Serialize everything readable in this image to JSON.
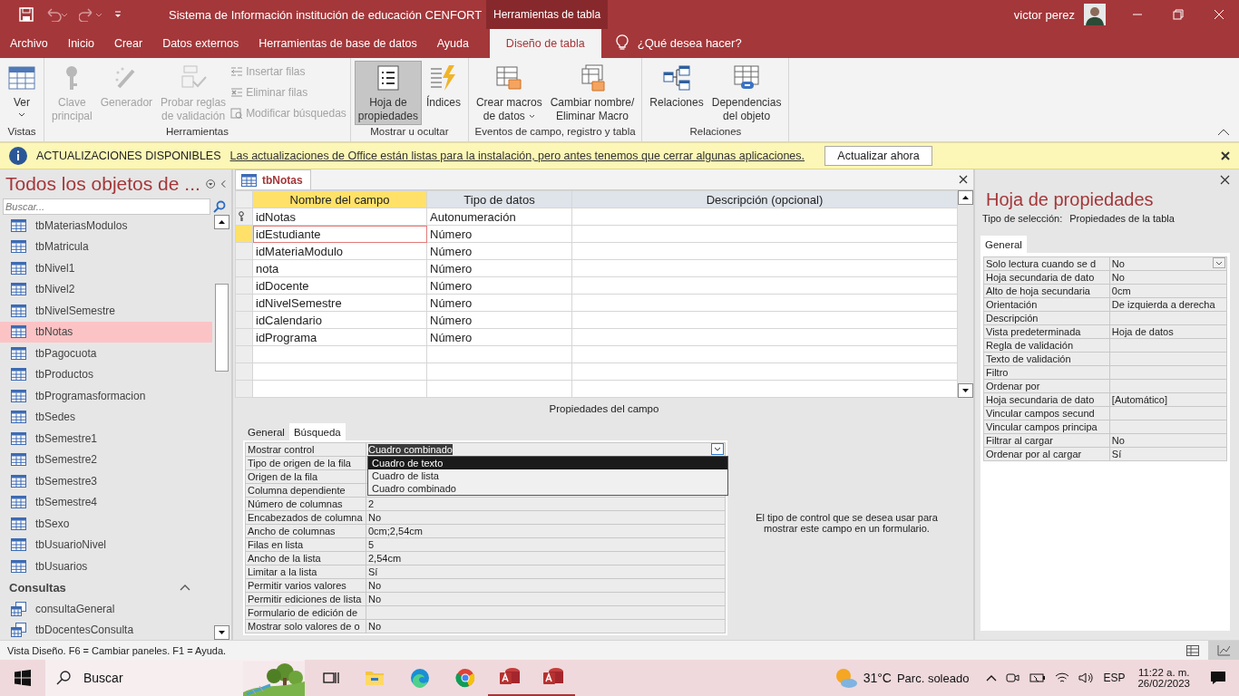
{
  "window": {
    "title": "Sistema de Información institución de educación CENFORT",
    "contextual_tab": "Herramientas de tabla",
    "user": "victor perez"
  },
  "ribbon_tabs": [
    {
      "label": "Archivo",
      "selected": false
    },
    {
      "label": "Inicio",
      "selected": false
    },
    {
      "label": "Crear",
      "selected": false
    },
    {
      "label": "Datos externos",
      "selected": false
    },
    {
      "label": "Herramientas de base de datos",
      "selected": false
    },
    {
      "label": "Ayuda",
      "selected": false
    },
    {
      "label": "Diseño de tabla",
      "selected": true
    }
  ],
  "tell_me": "¿Qué desea hacer?",
  "ribbon_groups": [
    {
      "label": "Vistas",
      "buttons": [
        {
          "kind": "large",
          "lines": [
            "Ver"
          ],
          "menu": true,
          "disabled": false,
          "selected": false
        }
      ]
    },
    {
      "label": "Herramientas",
      "buttons": [
        {
          "kind": "large",
          "lines": [
            "Clave",
            "principal"
          ],
          "disabled": true,
          "selected": false
        },
        {
          "kind": "large",
          "lines": [
            "Generador"
          ],
          "disabled": true,
          "selected": false
        },
        {
          "kind": "large",
          "lines": [
            "Probar reglas",
            "de validación"
          ],
          "disabled": true,
          "selected": false
        },
        {
          "kind": "small",
          "lines": [
            "Insertar filas"
          ],
          "disabled": true
        },
        {
          "kind": "small",
          "lines": [
            "Eliminar filas"
          ],
          "disabled": true
        },
        {
          "kind": "small",
          "lines": [
            "Modificar búsquedas"
          ],
          "disabled": true
        }
      ]
    },
    {
      "label": "Mostrar u ocultar",
      "buttons": [
        {
          "kind": "large",
          "lines": [
            "Hoja de",
            "propiedades"
          ],
          "disabled": false,
          "selected": true
        },
        {
          "kind": "large",
          "lines": [
            "Índices"
          ],
          "disabled": false,
          "selected": false
        }
      ]
    },
    {
      "label": "Eventos de campo, registro y tabla",
      "buttons": [
        {
          "kind": "large",
          "lines": [
            "Crear macros",
            "de datos"
          ],
          "menu": true,
          "disabled": false,
          "selected": false
        },
        {
          "kind": "large",
          "lines": [
            "Cambiar nombre/",
            "Eliminar Macro"
          ],
          "disabled": false,
          "selected": false
        }
      ]
    },
    {
      "label": "Relaciones",
      "buttons": [
        {
          "kind": "large",
          "lines": [
            "Relaciones"
          ],
          "disabled": false,
          "selected": false
        },
        {
          "kind": "large",
          "lines": [
            "Dependencias",
            "del objeto"
          ],
          "disabled": false,
          "selected": false
        }
      ]
    }
  ],
  "message_bar": {
    "title": "ACTUALIZACIONES DISPONIBLES",
    "text": "Las actualizaciones de Office están listas para la instalación, pero antes tenemos que cerrar algunas aplicaciones.",
    "button": "Actualizar ahora"
  },
  "nav": {
    "title": "Todos los objetos de ...",
    "search_placeholder": "Buscar...",
    "items": [
      {
        "label": "tbMateriasModulos",
        "selected": false
      },
      {
        "label": "tbMatricula",
        "selected": false
      },
      {
        "label": "tbNivel1",
        "selected": false
      },
      {
        "label": "tbNivel2",
        "selected": false
      },
      {
        "label": "tbNivelSemestre",
        "selected": false
      },
      {
        "label": "tbNotas",
        "selected": true
      },
      {
        "label": "tbPagocuota",
        "selected": false
      },
      {
        "label": "tbProductos",
        "selected": false
      },
      {
        "label": "tbProgramasformacion",
        "selected": false
      },
      {
        "label": "tbSedes",
        "selected": false
      },
      {
        "label": "tbSemestre1",
        "selected": false
      },
      {
        "label": "tbSemestre2",
        "selected": false
      },
      {
        "label": "tbSemestre3",
        "selected": false
      },
      {
        "label": "tbSemestre4",
        "selected": false
      },
      {
        "label": "tbSexo",
        "selected": false
      },
      {
        "label": "tbUsuarioNivel",
        "selected": false
      },
      {
        "label": "tbUsuarios",
        "selected": false
      }
    ],
    "sections": [
      {
        "label": "Consultas",
        "expanded": true,
        "items": [
          {
            "label": "consultaGeneral",
            "selected": false
          },
          {
            "label": "tbDocentesConsulta",
            "selected": false
          }
        ]
      }
    ]
  },
  "document_tab": "tbNotas",
  "design": {
    "columns": [
      {
        "label": "Nombre del campo",
        "selected": true
      },
      {
        "label": "Tipo de datos",
        "selected": false
      },
      {
        "label": "Descripción (opcional)",
        "selected": false
      }
    ],
    "rows": [
      {
        "name": "idNotas",
        "type": "Autonumeración",
        "primary_key": true,
        "selected": false
      },
      {
        "name": "idEstudiante",
        "type": "Número",
        "primary_key": false,
        "selected": true
      },
      {
        "name": "idMateriaModulo",
        "type": "Número",
        "primary_key": false,
        "selected": false
      },
      {
        "name": "nota",
        "type": "Número",
        "primary_key": false,
        "selected": false
      },
      {
        "name": "idDocente",
        "type": "Número",
        "primary_key": false,
        "selected": false
      },
      {
        "name": "idNivelSemestre",
        "type": "Número",
        "primary_key": false,
        "selected": false
      },
      {
        "name": "idCalendario",
        "type": "Número",
        "primary_key": false,
        "selected": false
      },
      {
        "name": "idPrograma",
        "type": "Número",
        "primary_key": false,
        "selected": false
      }
    ]
  },
  "field_properties": {
    "label": "Propiedades del campo",
    "tabs": [
      {
        "label": "General",
        "selected": false
      },
      {
        "label": "Búsqueda",
        "selected": true
      }
    ],
    "rows": [
      {
        "label": "Mostrar control",
        "value": "Cuadro combinado",
        "selected": true
      },
      {
        "label": "Tipo de origen de la fila"
      },
      {
        "label": "Origen de la fila"
      },
      {
        "label": "Columna dependiente"
      },
      {
        "label": "Número de columnas",
        "value": "2",
        "selected": false
      },
      {
        "label": "Encabezados de columna",
        "value": "No",
        "selected": false
      },
      {
        "label": "Ancho de columnas",
        "value": "0cm;2,54cm",
        "selected": false
      },
      {
        "label": "Filas en lista",
        "value": "5",
        "selected": false
      },
      {
        "label": "Ancho de la lista",
        "value": "2,54cm",
        "selected": false
      },
      {
        "label": "Limitar a la lista",
        "value": "Sí",
        "selected": false
      },
      {
        "label": "Permitir varios valores",
        "value": "No",
        "selected": false
      },
      {
        "label": "Permitir ediciones de lista",
        "value": "No",
        "selected": false
      },
      {
        "label": "Formulario de edición de",
        "selected": false
      },
      {
        "label": "Mostrar solo valores de o",
        "value": "No",
        "selected": false
      }
    ],
    "dropdown_options": [
      {
        "label": "Cuadro de texto",
        "selected": true
      },
      {
        "label": "Cuadro de lista",
        "selected": false
      },
      {
        "label": "Cuadro combinado",
        "selected": false
      }
    ],
    "help": "El tipo de control que se desea usar para mostrar este campo en un formulario."
  },
  "property_sheet": {
    "title": "Hoja de propiedades",
    "selection_label": "Tipo de selección:",
    "selection_value": "Propiedades de la tabla",
    "tabs": [
      {
        "label": "General",
        "selected": true
      }
    ],
    "rows": [
      {
        "label": "Solo lectura cuando se d",
        "value": "No",
        "selected": true
      },
      {
        "label": "Hoja secundaria de dato",
        "value": "No",
        "selected": false
      },
      {
        "label": "Alto de hoja secundaria",
        "value": "0cm",
        "selected": false
      },
      {
        "label": "Orientación",
        "value": "De izquierda a derecha",
        "selected": false
      },
      {
        "label": "Descripción",
        "selected": false
      },
      {
        "label": "Vista predeterminada",
        "value": "Hoja de datos",
        "selected": false
      },
      {
        "label": "Regla de validación",
        "selected": false
      },
      {
        "label": "Texto de validación",
        "selected": false
      },
      {
        "label": "Filtro",
        "selected": false
      },
      {
        "label": "Ordenar por",
        "selected": false
      },
      {
        "label": "Hoja secundaria de dato",
        "value": "[Automático]",
        "selected": false
      },
      {
        "label": "Vincular campos secund",
        "selected": false
      },
      {
        "label": "Vincular campos principa",
        "selected": false
      },
      {
        "label": "Filtrar al cargar",
        "value": "No",
        "selected": false
      },
      {
        "label": "Ordenar por al cargar",
        "value": "Sí",
        "selected": false
      }
    ]
  },
  "status_bar": {
    "text": "Vista Diseño.  F6 = Cambiar paneles.  F1 = Ayuda.",
    "views": [
      {
        "selected": false
      },
      {
        "selected": true
      }
    ]
  },
  "taskbar": {
    "search": "Buscar",
    "weather": "31°C",
    "weather_text": "Parc. soleado",
    "language": "ESP",
    "time": "11:22 a. m.",
    "date": "26/02/2023"
  }
}
